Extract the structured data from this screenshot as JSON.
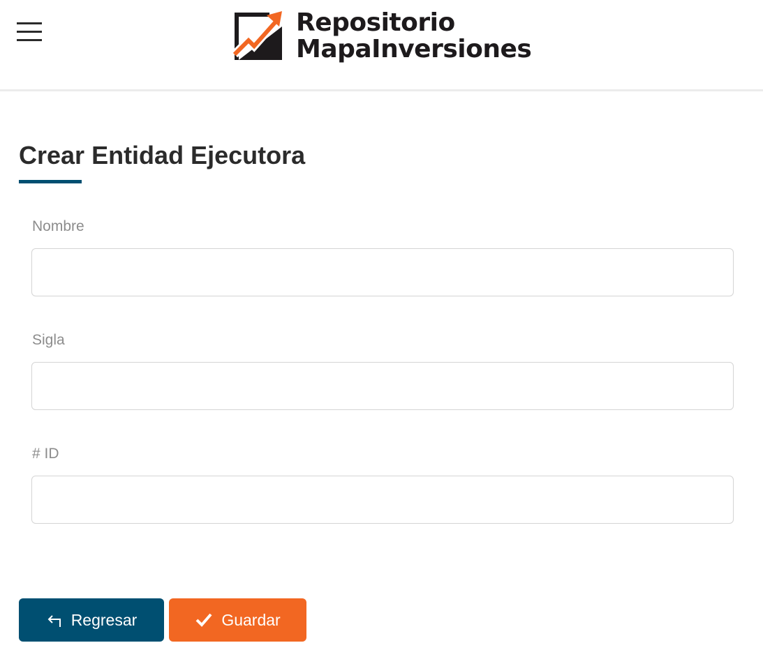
{
  "header": {
    "logo_line1": "Repositorio",
    "logo_line2": "MapaInversiones",
    "menu_icon": "hamburger-menu-icon"
  },
  "form": {
    "title": "Crear Entidad Ejecutora",
    "fields": [
      {
        "label": "Nombre",
        "value": "",
        "placeholder": ""
      },
      {
        "label": "Sigla",
        "value": "",
        "placeholder": ""
      },
      {
        "label": "# ID",
        "value": "",
        "placeholder": ""
      }
    ]
  },
  "actions": {
    "back_label": "Regresar",
    "back_icon": "return-arrow-icon",
    "save_label": "Guardar",
    "save_icon": "checkmark-icon"
  },
  "colors": {
    "primary": "#004f71",
    "accent": "#f26722",
    "title_text": "#2b2b2b",
    "label_text": "#8c8c8c"
  }
}
